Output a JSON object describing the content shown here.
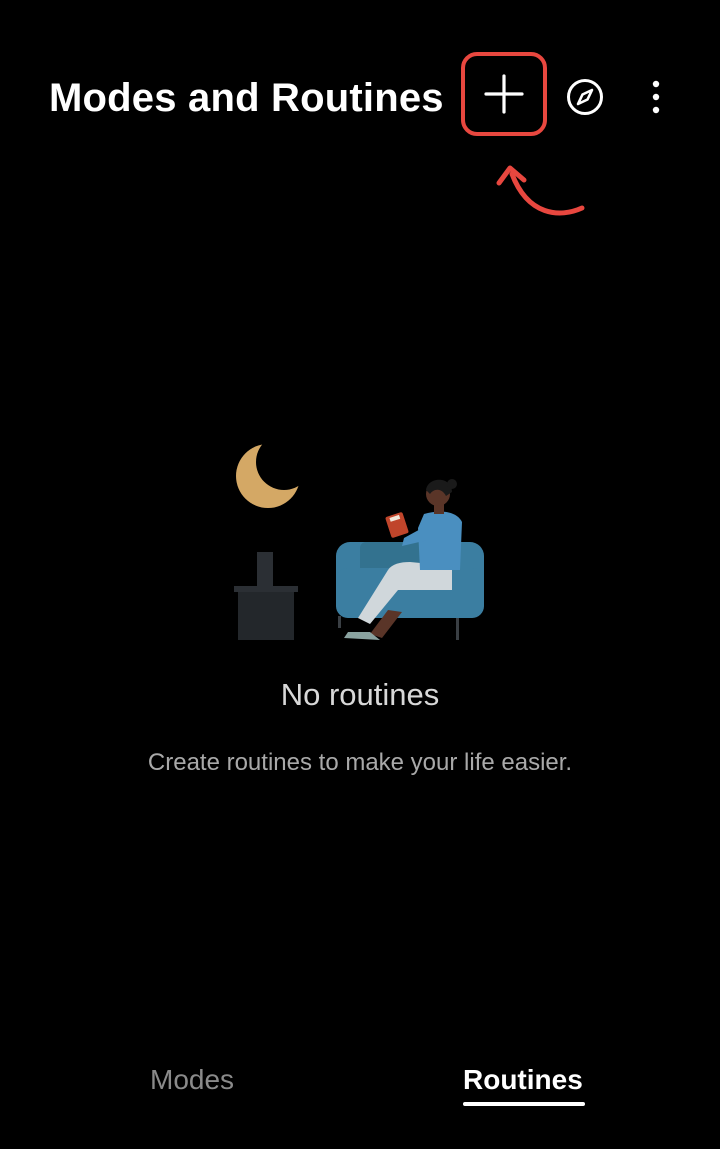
{
  "header": {
    "title": "Modes and Routines",
    "icons": {
      "add": "plus-icon",
      "discover": "compass-icon",
      "more": "more-vertical-icon"
    },
    "highlight_color": "#e8473f"
  },
  "empty_state": {
    "title": "No routines",
    "subtitle": "Create routines to make your life easier."
  },
  "tabs": [
    {
      "label": "Modes",
      "selected": false
    },
    {
      "label": "Routines",
      "selected": true
    }
  ],
  "colors": {
    "background": "#000000",
    "text_primary": "#ffffff",
    "text_secondary": "#a9a9a9",
    "tab_inactive": "#8a8a8a",
    "annotation": "#e8473f"
  }
}
